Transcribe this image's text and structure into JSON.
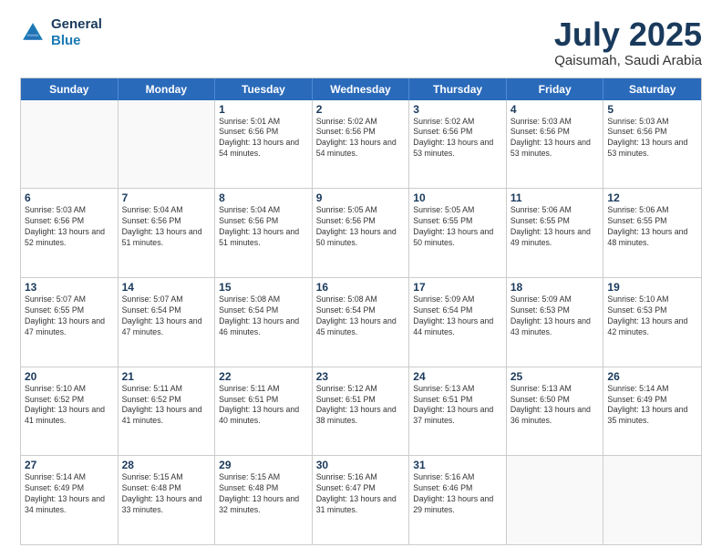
{
  "header": {
    "logo": {
      "line1": "General",
      "line2": "Blue"
    },
    "title": "July 2025",
    "subtitle": "Qaisumah, Saudi Arabia"
  },
  "days_of_week": [
    "Sunday",
    "Monday",
    "Tuesday",
    "Wednesday",
    "Thursday",
    "Friday",
    "Saturday"
  ],
  "weeks": [
    [
      {
        "day": "",
        "empty": true
      },
      {
        "day": "",
        "empty": true
      },
      {
        "day": "1",
        "sunrise": "5:01 AM",
        "sunset": "6:56 PM",
        "daylight": "13 hours and 54 minutes."
      },
      {
        "day": "2",
        "sunrise": "5:02 AM",
        "sunset": "6:56 PM",
        "daylight": "13 hours and 54 minutes."
      },
      {
        "day": "3",
        "sunrise": "5:02 AM",
        "sunset": "6:56 PM",
        "daylight": "13 hours and 53 minutes."
      },
      {
        "day": "4",
        "sunrise": "5:03 AM",
        "sunset": "6:56 PM",
        "daylight": "13 hours and 53 minutes."
      },
      {
        "day": "5",
        "sunrise": "5:03 AM",
        "sunset": "6:56 PM",
        "daylight": "13 hours and 53 minutes."
      }
    ],
    [
      {
        "day": "6",
        "sunrise": "5:03 AM",
        "sunset": "6:56 PM",
        "daylight": "13 hours and 52 minutes."
      },
      {
        "day": "7",
        "sunrise": "5:04 AM",
        "sunset": "6:56 PM",
        "daylight": "13 hours and 51 minutes."
      },
      {
        "day": "8",
        "sunrise": "5:04 AM",
        "sunset": "6:56 PM",
        "daylight": "13 hours and 51 minutes."
      },
      {
        "day": "9",
        "sunrise": "5:05 AM",
        "sunset": "6:56 PM",
        "daylight": "13 hours and 50 minutes."
      },
      {
        "day": "10",
        "sunrise": "5:05 AM",
        "sunset": "6:55 PM",
        "daylight": "13 hours and 50 minutes."
      },
      {
        "day": "11",
        "sunrise": "5:06 AM",
        "sunset": "6:55 PM",
        "daylight": "13 hours and 49 minutes."
      },
      {
        "day": "12",
        "sunrise": "5:06 AM",
        "sunset": "6:55 PM",
        "daylight": "13 hours and 48 minutes."
      }
    ],
    [
      {
        "day": "13",
        "sunrise": "5:07 AM",
        "sunset": "6:55 PM",
        "daylight": "13 hours and 47 minutes."
      },
      {
        "day": "14",
        "sunrise": "5:07 AM",
        "sunset": "6:54 PM",
        "daylight": "13 hours and 47 minutes."
      },
      {
        "day": "15",
        "sunrise": "5:08 AM",
        "sunset": "6:54 PM",
        "daylight": "13 hours and 46 minutes."
      },
      {
        "day": "16",
        "sunrise": "5:08 AM",
        "sunset": "6:54 PM",
        "daylight": "13 hours and 45 minutes."
      },
      {
        "day": "17",
        "sunrise": "5:09 AM",
        "sunset": "6:54 PM",
        "daylight": "13 hours and 44 minutes."
      },
      {
        "day": "18",
        "sunrise": "5:09 AM",
        "sunset": "6:53 PM",
        "daylight": "13 hours and 43 minutes."
      },
      {
        "day": "19",
        "sunrise": "5:10 AM",
        "sunset": "6:53 PM",
        "daylight": "13 hours and 42 minutes."
      }
    ],
    [
      {
        "day": "20",
        "sunrise": "5:10 AM",
        "sunset": "6:52 PM",
        "daylight": "13 hours and 41 minutes."
      },
      {
        "day": "21",
        "sunrise": "5:11 AM",
        "sunset": "6:52 PM",
        "daylight": "13 hours and 41 minutes."
      },
      {
        "day": "22",
        "sunrise": "5:11 AM",
        "sunset": "6:51 PM",
        "daylight": "13 hours and 40 minutes."
      },
      {
        "day": "23",
        "sunrise": "5:12 AM",
        "sunset": "6:51 PM",
        "daylight": "13 hours and 38 minutes."
      },
      {
        "day": "24",
        "sunrise": "5:13 AM",
        "sunset": "6:51 PM",
        "daylight": "13 hours and 37 minutes."
      },
      {
        "day": "25",
        "sunrise": "5:13 AM",
        "sunset": "6:50 PM",
        "daylight": "13 hours and 36 minutes."
      },
      {
        "day": "26",
        "sunrise": "5:14 AM",
        "sunset": "6:49 PM",
        "daylight": "13 hours and 35 minutes."
      }
    ],
    [
      {
        "day": "27",
        "sunrise": "5:14 AM",
        "sunset": "6:49 PM",
        "daylight": "13 hours and 34 minutes."
      },
      {
        "day": "28",
        "sunrise": "5:15 AM",
        "sunset": "6:48 PM",
        "daylight": "13 hours and 33 minutes."
      },
      {
        "day": "29",
        "sunrise": "5:15 AM",
        "sunset": "6:48 PM",
        "daylight": "13 hours and 32 minutes."
      },
      {
        "day": "30",
        "sunrise": "5:16 AM",
        "sunset": "6:47 PM",
        "daylight": "13 hours and 31 minutes."
      },
      {
        "day": "31",
        "sunrise": "5:16 AM",
        "sunset": "6:46 PM",
        "daylight": "13 hours and 29 minutes."
      },
      {
        "day": "",
        "empty": true
      },
      {
        "day": "",
        "empty": true
      }
    ]
  ]
}
